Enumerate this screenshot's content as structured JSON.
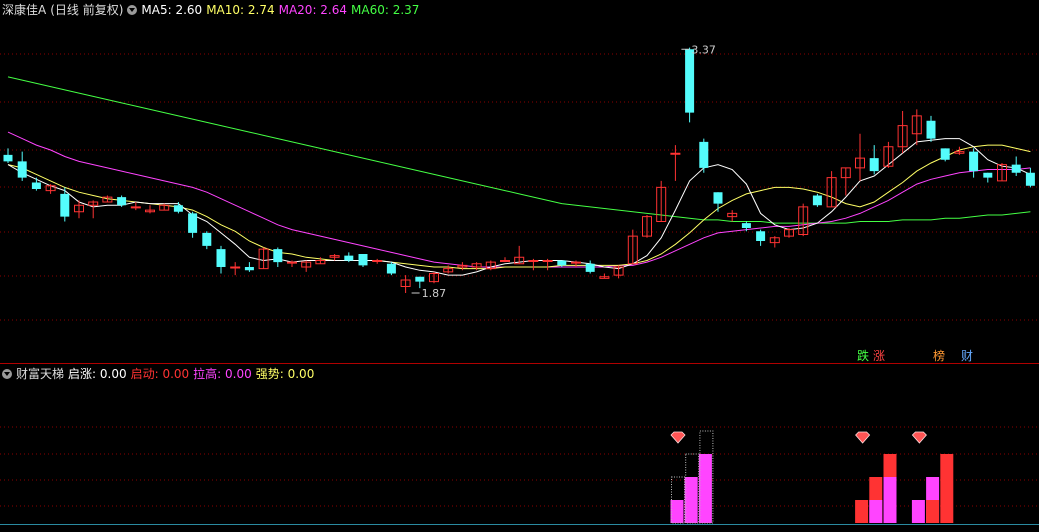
{
  "header": {
    "stock": "深康佳A",
    "period": "(日线 前复权)",
    "ma": [
      {
        "label": "MA5: 2.60",
        "color": "#ffffff"
      },
      {
        "label": "MA10: 2.74",
        "color": "#ffff66"
      },
      {
        "label": "MA20: 2.64",
        "color": "#ff44ff"
      },
      {
        "label": "MA60: 2.37",
        "color": "#44ff44"
      }
    ]
  },
  "indicator": {
    "name": "财富天梯",
    "items": [
      {
        "label": "启涨: 0.00",
        "color": "#ffffff"
      },
      {
        "label": "启动: 0.00",
        "color": "#ff3333"
      },
      {
        "label": "拉高: 0.00",
        "color": "#ff44ff"
      },
      {
        "label": "强势: 0.00",
        "color": "#ffff66"
      }
    ]
  },
  "tags": [
    {
      "text": "跌",
      "color": "#44ff44"
    },
    {
      "text": "涨",
      "color": "#ff4444"
    },
    {
      "text": "榜",
      "color": "#ff9933"
    },
    {
      "text": "财",
      "color": "#66aaff"
    }
  ],
  "colors": {
    "up": "#ff3333",
    "down": "#54fcfc",
    "ma5": "#ffffff",
    "ma10": "#ffff66",
    "ma20": "#ff44ff",
    "ma60": "#44ff44",
    "grid": "#8b0000",
    "diamond": "#ff5555"
  },
  "chart_data": {
    "type": "candlestick",
    "ylim": [
      1.55,
      3.55
    ],
    "annotations": [
      {
        "text": "3.37",
        "index": 47,
        "value": 3.37
      },
      {
        "text": "1.87",
        "index": 28,
        "value": 1.87
      }
    ],
    "candles": [
      [
        2.72,
        2.76,
        2.67,
        2.68
      ],
      [
        2.68,
        2.74,
        2.56,
        2.58
      ],
      [
        2.55,
        2.58,
        2.5,
        2.51
      ],
      [
        2.5,
        2.54,
        2.48,
        2.53
      ],
      [
        2.48,
        2.52,
        2.31,
        2.34
      ],
      [
        2.37,
        2.44,
        2.33,
        2.41
      ],
      [
        2.41,
        2.44,
        2.33,
        2.43
      ],
      [
        2.43,
        2.47,
        2.43,
        2.46
      ],
      [
        2.46,
        2.47,
        2.4,
        2.41
      ],
      [
        2.4,
        2.43,
        2.38,
        2.4
      ],
      [
        2.37,
        2.41,
        2.36,
        2.38
      ],
      [
        2.38,
        2.42,
        2.38,
        2.41
      ],
      [
        2.41,
        2.43,
        2.36,
        2.37
      ],
      [
        2.36,
        2.37,
        2.21,
        2.24
      ],
      [
        2.24,
        2.25,
        2.14,
        2.16
      ],
      [
        2.14,
        2.16,
        1.99,
        2.03
      ],
      [
        2.03,
        2.06,
        1.98,
        2.03
      ],
      [
        2.03,
        2.06,
        2.0,
        2.01
      ],
      [
        2.02,
        2.15,
        2.02,
        2.14
      ],
      [
        2.14,
        2.15,
        2.03,
        2.06
      ],
      [
        2.06,
        2.07,
        2.03,
        2.06
      ],
      [
        2.03,
        2.07,
        2.0,
        2.06
      ],
      [
        2.05,
        2.09,
        2.05,
        2.07
      ],
      [
        2.09,
        2.11,
        2.07,
        2.1
      ],
      [
        2.1,
        2.12,
        2.06,
        2.07
      ],
      [
        2.11,
        2.11,
        2.03,
        2.04
      ],
      [
        2.07,
        2.08,
        2.05,
        2.07
      ],
      [
        2.05,
        2.06,
        1.98,
        1.99
      ],
      [
        1.91,
        1.98,
        1.87,
        1.95
      ],
      [
        1.97,
        1.97,
        1.9,
        1.94
      ],
      [
        1.94,
        2.0,
        1.93,
        1.99
      ],
      [
        2.0,
        2.04,
        1.99,
        2.02
      ],
      [
        2.03,
        2.06,
        2.01,
        2.04
      ],
      [
        2.03,
        2.06,
        2.01,
        2.05
      ],
      [
        2.02,
        2.07,
        2.01,
        2.06
      ],
      [
        2.07,
        2.09,
        2.06,
        2.07
      ],
      [
        2.05,
        2.16,
        2.05,
        2.09
      ],
      [
        2.07,
        2.08,
        2.01,
        2.07
      ],
      [
        2.07,
        2.08,
        2.01,
        2.07
      ],
      [
        2.07,
        2.07,
        2.03,
        2.04
      ],
      [
        2.06,
        2.07,
        2.03,
        2.06
      ],
      [
        2.05,
        2.07,
        1.99,
        2.0
      ],
      [
        1.96,
        1.99,
        1.96,
        1.97
      ],
      [
        1.98,
        2.04,
        1.96,
        2.03
      ],
      [
        2.05,
        2.26,
        2.05,
        2.22
      ],
      [
        2.22,
        2.35,
        2.21,
        2.34
      ],
      [
        2.31,
        2.56,
        2.31,
        2.52
      ],
      [
        2.73,
        2.78,
        2.56,
        2.73
      ],
      [
        3.37,
        3.38,
        2.92,
        2.98
      ],
      [
        2.8,
        2.82,
        2.61,
        2.64
      ],
      [
        2.49,
        2.49,
        2.37,
        2.42
      ],
      [
        2.34,
        2.38,
        2.31,
        2.36
      ],
      [
        2.3,
        2.31,
        2.25,
        2.27
      ],
      [
        2.25,
        2.26,
        2.16,
        2.19
      ],
      [
        2.18,
        2.22,
        2.15,
        2.21
      ],
      [
        2.22,
        2.27,
        2.21,
        2.26
      ],
      [
        2.23,
        2.42,
        2.22,
        2.4
      ],
      [
        2.47,
        2.48,
        2.4,
        2.41
      ],
      [
        2.4,
        2.62,
        2.4,
        2.58
      ],
      [
        2.58,
        2.64,
        2.47,
        2.64
      ],
      [
        2.64,
        2.85,
        2.56,
        2.7
      ],
      [
        2.7,
        2.78,
        2.6,
        2.62
      ],
      [
        2.65,
        2.8,
        2.64,
        2.77
      ],
      [
        2.77,
        2.99,
        2.73,
        2.9
      ],
      [
        2.85,
        3.0,
        2.78,
        2.96
      ],
      [
        2.93,
        2.96,
        2.8,
        2.82
      ],
      [
        2.76,
        2.76,
        2.68,
        2.69
      ],
      [
        2.73,
        2.77,
        2.72,
        2.74
      ],
      [
        2.74,
        2.76,
        2.58,
        2.62
      ],
      [
        2.61,
        2.61,
        2.55,
        2.58
      ],
      [
        2.56,
        2.67,
        2.56,
        2.66
      ],
      [
        2.66,
        2.71,
        2.59,
        2.61
      ],
      [
        2.61,
        2.64,
        2.52,
        2.53
      ]
    ],
    "ma5": [
      2.66,
      2.61,
      2.57,
      2.53,
      2.5,
      2.43,
      2.4,
      2.41,
      2.41,
      2.43,
      2.42,
      2.42,
      2.42,
      2.35,
      2.31,
      2.24,
      2.17,
      2.09,
      2.07,
      2.08,
      2.06,
      2.07,
      2.07,
      2.07,
      2.07,
      2.07,
      2.07,
      2.06,
      2.03,
      2.01,
      2.0,
      1.98,
      1.98,
      2.0,
      2.03,
      2.05,
      2.06,
      2.07,
      2.07,
      2.07,
      2.06,
      2.05,
      2.03,
      2.02,
      2.05,
      2.1,
      2.21,
      2.38,
      2.56,
      2.64,
      2.66,
      2.63,
      2.54,
      2.36,
      2.29,
      2.26,
      2.27,
      2.3,
      2.37,
      2.46,
      2.56,
      2.59,
      2.66,
      2.73,
      2.8,
      2.81,
      2.82,
      2.82,
      2.77,
      2.69,
      2.65,
      2.64,
      2.6
    ],
    "ma10": [
      2.66,
      2.64,
      2.6,
      2.56,
      2.52,
      2.49,
      2.47,
      2.45,
      2.44,
      2.43,
      2.42,
      2.41,
      2.4,
      2.38,
      2.34,
      2.29,
      2.25,
      2.19,
      2.15,
      2.12,
      2.11,
      2.09,
      2.08,
      2.07,
      2.07,
      2.07,
      2.07,
      2.06,
      2.05,
      2.04,
      2.03,
      2.03,
      2.02,
      2.02,
      2.02,
      2.03,
      2.03,
      2.03,
      2.03,
      2.04,
      2.04,
      2.04,
      2.04,
      2.04,
      2.05,
      2.07,
      2.11,
      2.17,
      2.24,
      2.32,
      2.39,
      2.44,
      2.48,
      2.5,
      2.52,
      2.52,
      2.51,
      2.49,
      2.46,
      2.42,
      2.4,
      2.43,
      2.49,
      2.55,
      2.62,
      2.67,
      2.71,
      2.75,
      2.77,
      2.78,
      2.78,
      2.76,
      2.74
    ],
    "ma20": [
      2.86,
      2.82,
      2.78,
      2.75,
      2.71,
      2.68,
      2.66,
      2.64,
      2.62,
      2.6,
      2.58,
      2.56,
      2.54,
      2.52,
      2.49,
      2.45,
      2.41,
      2.37,
      2.33,
      2.29,
      2.26,
      2.24,
      2.22,
      2.2,
      2.18,
      2.16,
      2.14,
      2.12,
      2.1,
      2.08,
      2.06,
      2.05,
      2.04,
      2.03,
      2.03,
      2.03,
      2.03,
      2.03,
      2.03,
      2.03,
      2.03,
      2.03,
      2.03,
      2.04,
      2.04,
      2.06,
      2.09,
      2.13,
      2.17,
      2.21,
      2.24,
      2.25,
      2.26,
      2.27,
      2.28,
      2.28,
      2.29,
      2.3,
      2.31,
      2.33,
      2.36,
      2.4,
      2.44,
      2.49,
      2.54,
      2.57,
      2.59,
      2.61,
      2.62,
      2.63,
      2.63,
      2.63,
      2.64
    ],
    "ma60": [
      3.2,
      3.18,
      3.16,
      3.14,
      3.12,
      3.1,
      3.08,
      3.06,
      3.04,
      3.02,
      3.0,
      2.98,
      2.96,
      2.94,
      2.92,
      2.9,
      2.88,
      2.86,
      2.84,
      2.82,
      2.8,
      2.78,
      2.76,
      2.74,
      2.72,
      2.7,
      2.68,
      2.66,
      2.64,
      2.62,
      2.6,
      2.58,
      2.56,
      2.54,
      2.52,
      2.5,
      2.48,
      2.46,
      2.44,
      2.42,
      2.41,
      2.4,
      2.39,
      2.38,
      2.37,
      2.36,
      2.35,
      2.34,
      2.33,
      2.32,
      2.32,
      2.31,
      2.31,
      2.31,
      2.3,
      2.3,
      2.3,
      2.3,
      2.3,
      2.3,
      2.31,
      2.31,
      2.31,
      2.32,
      2.32,
      2.32,
      2.33,
      2.33,
      2.34,
      2.35,
      2.35,
      2.36,
      2.37
    ],
    "indicator_bars": [
      {
        "index": 45,
        "series": "拉高",
        "value": 1
      },
      {
        "index": 45,
        "series": "启涨",
        "value": 2
      },
      {
        "index": 46,
        "series": "拉高",
        "value": 2
      },
      {
        "index": 46,
        "series": "启涨",
        "value": 3
      },
      {
        "index": 47,
        "series": "拉高",
        "value": 3
      },
      {
        "index": 47,
        "series": "启涨",
        "value": 4
      },
      {
        "index": 58,
        "series": "启动",
        "value": 1
      },
      {
        "index": 59,
        "series": "启动",
        "value": 2
      },
      {
        "index": 59,
        "series": "拉高",
        "value": 1
      },
      {
        "index": 60,
        "series": "启动",
        "value": 3
      },
      {
        "index": 60,
        "series": "拉高",
        "value": 2
      },
      {
        "index": 62,
        "series": "拉高",
        "value": 1
      },
      {
        "index": 63,
        "series": "拉高",
        "value": 2
      },
      {
        "index": 63,
        "series": "启动",
        "value": 1
      },
      {
        "index": 64,
        "series": "启动",
        "value": 3
      }
    ],
    "diamonds": [
      45,
      58,
      62
    ]
  }
}
